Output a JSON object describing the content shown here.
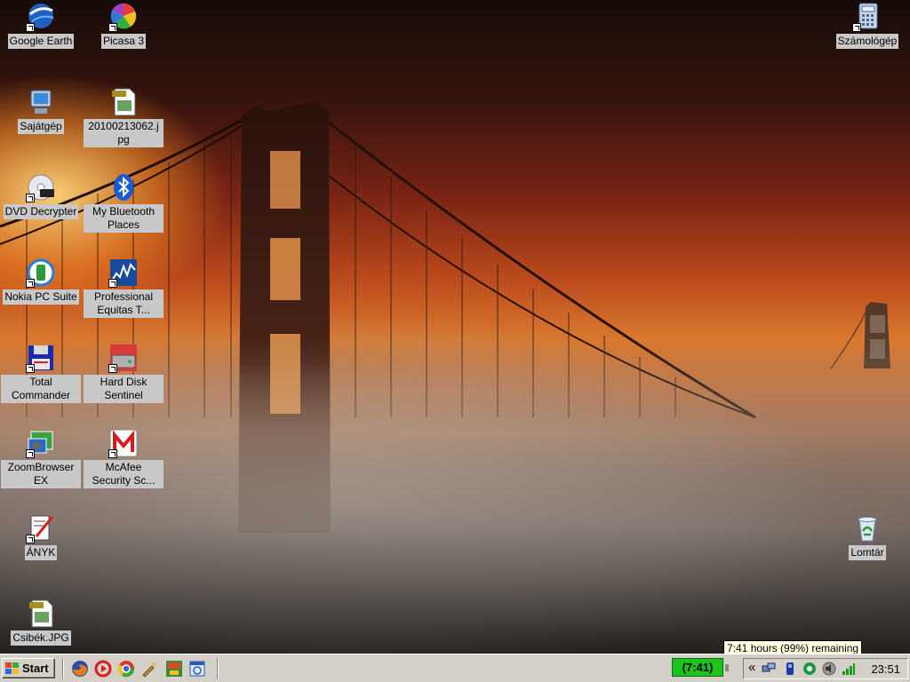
{
  "desktop_icons": [
    {
      "id": "google-earth",
      "label": "Google Earth",
      "icon": "globe-icon"
    },
    {
      "id": "picasa",
      "label": "Picasa 3",
      "icon": "pinwheel-icon"
    },
    {
      "id": "my-computer",
      "label": "Sajátgép",
      "icon": "computer-icon"
    },
    {
      "id": "jpg-file",
      "label": "20100213062.jpg",
      "icon": "jpg-file-icon"
    },
    {
      "id": "dvd-decrypter",
      "label": "DVD Decrypter",
      "icon": "dvd-icon"
    },
    {
      "id": "bluetooth",
      "label": "My Bluetooth Places",
      "icon": "bluetooth-icon"
    },
    {
      "id": "nokia-pc-suite",
      "label": "Nokia PC Suite",
      "icon": "nokia-icon"
    },
    {
      "id": "professional-equitas",
      "label": "Professional Equitas T...",
      "icon": "chart-icon"
    },
    {
      "id": "total-commander",
      "label": "Total Commander",
      "icon": "floppy-icon"
    },
    {
      "id": "hard-disk-sentinel",
      "label": "Hard Disk Sentinel",
      "icon": "harddisk-icon"
    },
    {
      "id": "zoombrowser",
      "label": "ZoomBrowser EX",
      "icon": "photo-icon"
    },
    {
      "id": "mcafee",
      "label": "McAfee Security Sc...",
      "icon": "mcafee-icon"
    },
    {
      "id": "anyk",
      "label": "ÁNYK",
      "icon": "form-pen-icon"
    },
    {
      "id": "csibek",
      "label": "Csibék.JPG",
      "icon": "jpg-file-icon"
    },
    {
      "id": "calculator",
      "label": "Számológép",
      "icon": "calculator-icon"
    },
    {
      "id": "recycle-bin",
      "label": "Lomtár",
      "icon": "recycle-bin-icon"
    }
  ],
  "taskbar": {
    "start_label": "Start",
    "quick_launch": [
      "firefox-icon",
      "media-player-icon",
      "chrome-icon",
      "tool-icon",
      "game-icon",
      "browser-icon"
    ],
    "battery_indicator": "(7:41)",
    "tooltip": "7:41 hours (99%) remaining",
    "tray_expand": "«",
    "tray_icons": [
      "network-icon",
      "usb-icon",
      "antivirus-icon",
      "speaker-icon",
      "signal-icon"
    ],
    "clock": "23:51"
  },
  "colors": {
    "taskbar": "#d4d0c8",
    "tooltip": "#ffffe1",
    "battery": "#1ec41e"
  }
}
